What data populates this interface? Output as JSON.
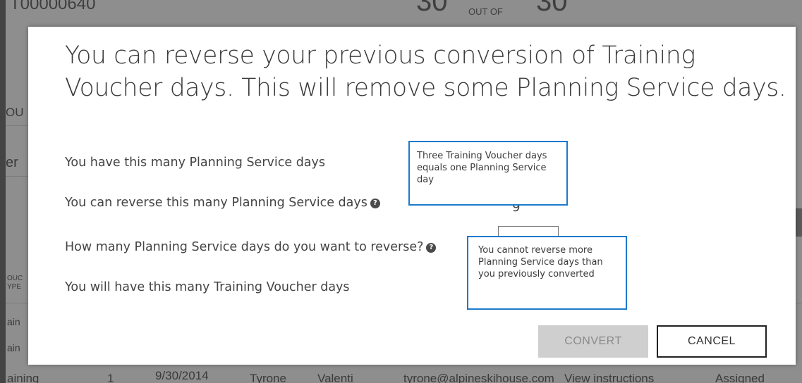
{
  "background": {
    "record_id": "T00000640",
    "count_used": "30",
    "out_of_label": "OUT OF",
    "count_total": "30",
    "partial_labels": [
      "OU",
      "er",
      "OUC",
      "YPE",
      "ain",
      "ain"
    ],
    "table_row": {
      "type": "aining",
      "quantity": "1",
      "date": "9/30/2014",
      "first_name": "Tyrone",
      "last_name": "Valenti",
      "email": "tyrone@alpineskihouse.com",
      "instructions_link": "View instructions",
      "status": "Assigned"
    }
  },
  "dialog": {
    "title": "You can reverse your previous conversion of Training Voucher days. This will remove some Planning Service days.",
    "rows": {
      "planning_days_label": "You have this many Planning Service days",
      "reverse_max_label": "You can reverse this many Planning Service days",
      "reverse_input_label": "How many Planning Service days do you want to reverse?",
      "voucher_days_label": "You will have this many Training Voucher days"
    },
    "help_icon_glyph": "?",
    "reverse_max_value_partial": "9",
    "reverse_input_value": "",
    "callouts": {
      "conversion_rate": "Three Training Voucher days equals one Planning Service day",
      "reverse_limit": "You cannot reverse more Planning Service days than you previously converted"
    },
    "buttons": {
      "convert": "CONVERT",
      "cancel": "CANCEL"
    },
    "colors": {
      "callout_border": "#1c7acb",
      "convert_disabled_bg": "#cfcfcf",
      "cancel_border": "#222222"
    }
  }
}
